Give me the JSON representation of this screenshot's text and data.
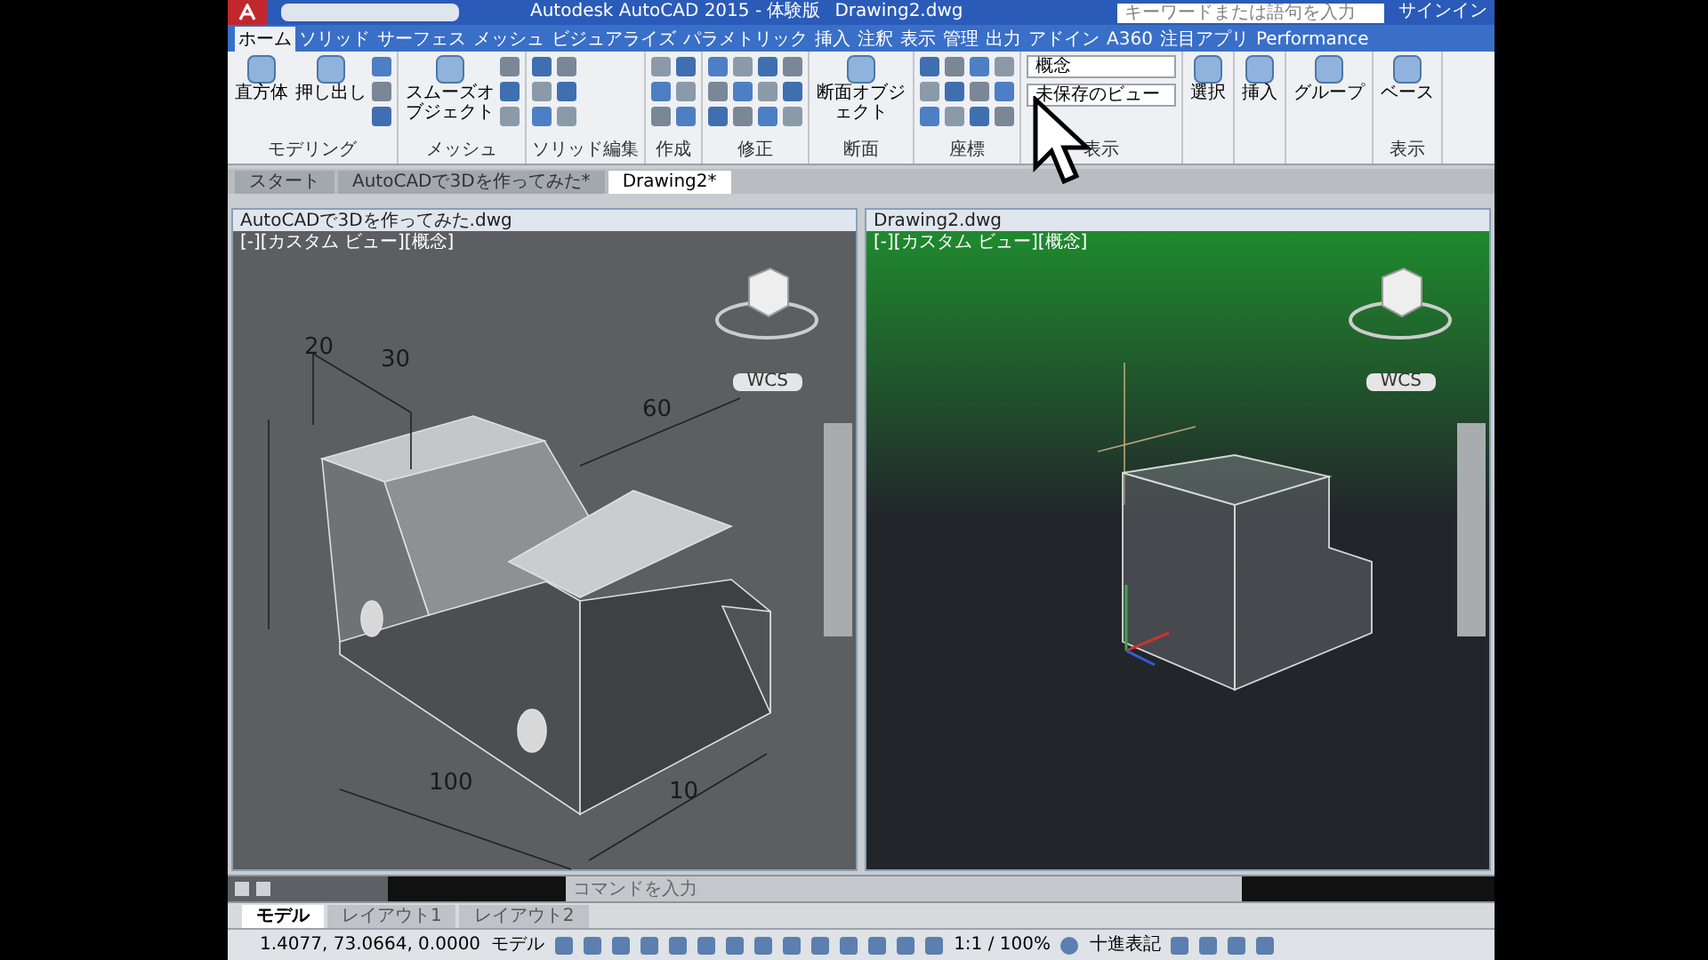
{
  "app_title": "Autodesk AutoCAD 2015 - 体験版",
  "file_title": "Drawing2.dwg",
  "search": {
    "placeholder": "キーワードまたは語句を入力"
  },
  "sign_in": "サインイン",
  "ribbon_tabs": [
    {
      "label": "ホーム",
      "selected": true
    },
    {
      "label": "ソリッド",
      "selected": false
    },
    {
      "label": "サーフェス",
      "selected": false
    },
    {
      "label": "メッシュ",
      "selected": false
    },
    {
      "label": "ビジュアライズ",
      "selected": false
    },
    {
      "label": "パラメトリック",
      "selected": false
    },
    {
      "label": "挿入",
      "selected": false
    },
    {
      "label": "注釈",
      "selected": false
    },
    {
      "label": "表示",
      "selected": false
    },
    {
      "label": "管理",
      "selected": false
    },
    {
      "label": "出力",
      "selected": false
    },
    {
      "label": "アドイン",
      "selected": false
    },
    {
      "label": "A360",
      "selected": false
    },
    {
      "label": "注目アプリ",
      "selected": false
    },
    {
      "label": "Performance",
      "selected": false
    }
  ],
  "ribbon_panels": [
    {
      "label": "モデリング",
      "buttons": [
        "直方体",
        "押し出し"
      ]
    },
    {
      "label": "メッシュ",
      "buttons": [
        "スムーズオブジェクト"
      ]
    },
    {
      "label": "ソリッド編集"
    },
    {
      "label": "作成"
    },
    {
      "label": "修正"
    },
    {
      "label": "断面",
      "buttons": [
        "断面オブジェクト"
      ]
    },
    {
      "label": "座標"
    },
    {
      "label": "表示",
      "combos": [
        "概念",
        "未保存のビュー"
      ]
    },
    {
      "buttons": [
        "選択"
      ]
    },
    {
      "buttons": [
        "挿入"
      ]
    },
    {
      "buttons": [
        "グループ"
      ]
    },
    {
      "label": "表示",
      "buttons": [
        "ベース"
      ]
    }
  ],
  "doc_tabs": [
    {
      "label": "スタート",
      "selected": false
    },
    {
      "label": "AutoCADで3Dを作ってみた*",
      "selected": false
    },
    {
      "label": "Drawing2*",
      "selected": true
    }
  ],
  "viewports": [
    {
      "title": "AutoCADで3Dを作ってみた.dwg",
      "label": "[-][カスタム ビュー][概念]",
      "kind": "dimensioned",
      "wcs": "WCS",
      "dims": [
        "20",
        "30",
        "60",
        "100",
        "10"
      ]
    },
    {
      "title": "Drawing2.dwg",
      "label": "[-][カスタム ビュー][概念]",
      "kind": "plain",
      "wcs": "WCS"
    }
  ],
  "command_line": {
    "placeholder": "コマンドを入力"
  },
  "layout_tabs": [
    {
      "label": "モデル",
      "selected": true
    },
    {
      "label": "レイアウト1",
      "selected": false
    },
    {
      "label": "レイアウト2",
      "selected": false
    }
  ],
  "status_bar": {
    "coordinates": "1.4077, 73.0664, 0.0000",
    "space": "モデル",
    "scale": "1:1 / 100%",
    "units": "十進表記"
  }
}
